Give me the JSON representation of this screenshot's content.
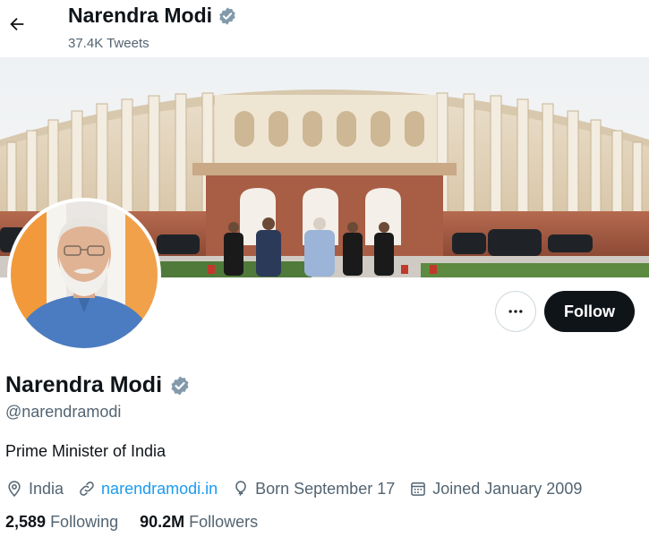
{
  "header": {
    "name": "Narendra Modi",
    "tweet_count": "37.4K Tweets"
  },
  "profile": {
    "name": "Narendra Modi",
    "handle": "@narendramodi",
    "bio": "Prime Minister of India",
    "verified": true,
    "location": "India",
    "website": "narendramodi.in",
    "birthday": "Born September 17",
    "joined": "Joined January 2009"
  },
  "stats": {
    "following_count": "2,589",
    "following_label": "Following",
    "followers_count": "90.2M",
    "followers_label": "Followers"
  },
  "actions": {
    "more_icon": "ellipsis-icon",
    "follow_label": "Follow"
  },
  "icons": {
    "back": "arrow-left-icon",
    "verified": "verified-badge-icon",
    "location": "location-pin-icon",
    "link": "link-icon",
    "birthday": "balloon-icon",
    "joined": "calendar-icon"
  },
  "colors": {
    "text_primary": "#0f1419",
    "text_secondary": "#536471",
    "link": "#1d9bf0",
    "follow_button_bg": "#0f1419",
    "verified_badge": "#829aab"
  }
}
